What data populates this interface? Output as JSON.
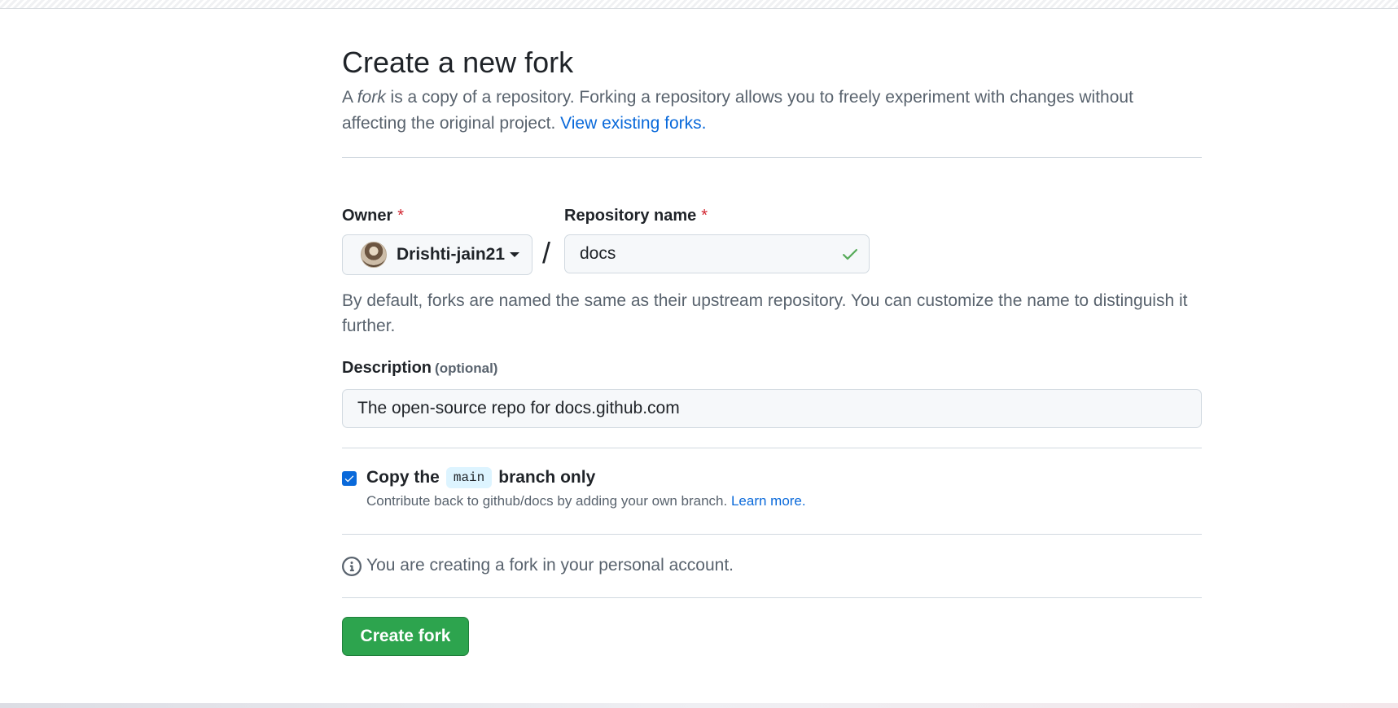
{
  "page": {
    "title": "Create a new fork",
    "intro_prefix": "A ",
    "intro_fork_word": "fork",
    "intro_text": " is a copy of a repository. Forking a repository allows you to freely experiment with changes without affecting the original project. ",
    "view_forks_link": "View existing forks."
  },
  "owner": {
    "label": "Owner",
    "required_mark": "*",
    "selected": "Drishti-jain21"
  },
  "repository": {
    "label": "Repository name",
    "required_mark": "*",
    "value": "docs",
    "separator": "/",
    "valid_icon": "check-icon",
    "hint": "By default, forks are named the same as their upstream repository. You can customize the name to distinguish it further."
  },
  "description": {
    "label": "Description",
    "optional_label": "(optional)",
    "value": "The open-source repo for docs.github.com"
  },
  "copy_branch": {
    "checked": true,
    "label_prefix": "Copy the",
    "branch": "main",
    "label_suffix": "branch only",
    "sub_text": "Contribute back to github/docs by adding your own branch. ",
    "learn_more": "Learn more."
  },
  "notice": {
    "icon": "info-icon",
    "text": "You are creating a fork in your personal account."
  },
  "actions": {
    "create_label": "Create fork"
  },
  "colors": {
    "primary_button": "#2da44e",
    "link": "#0969da",
    "required": "#d1242f",
    "checkbox": "#0969da",
    "valid_check": "#57ab5a"
  }
}
